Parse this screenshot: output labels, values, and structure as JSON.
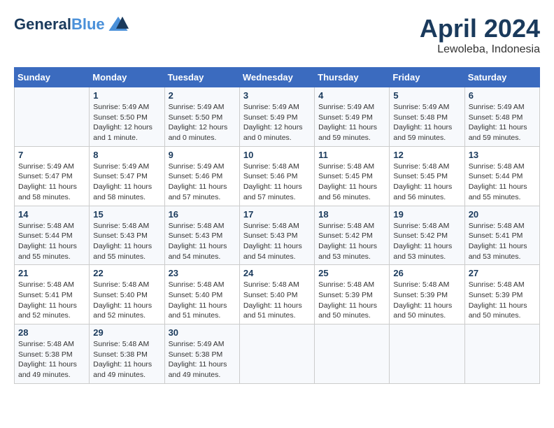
{
  "header": {
    "logo_line1": "General",
    "logo_line2": "Blue",
    "month": "April 2024",
    "location": "Lewoleba, Indonesia"
  },
  "days_of_week": [
    "Sunday",
    "Monday",
    "Tuesday",
    "Wednesday",
    "Thursday",
    "Friday",
    "Saturday"
  ],
  "weeks": [
    [
      {
        "day": "",
        "info": ""
      },
      {
        "day": "1",
        "info": "Sunrise: 5:49 AM\nSunset: 5:50 PM\nDaylight: 12 hours\nand 1 minute."
      },
      {
        "day": "2",
        "info": "Sunrise: 5:49 AM\nSunset: 5:50 PM\nDaylight: 12 hours\nand 0 minutes."
      },
      {
        "day": "3",
        "info": "Sunrise: 5:49 AM\nSunset: 5:49 PM\nDaylight: 12 hours\nand 0 minutes."
      },
      {
        "day": "4",
        "info": "Sunrise: 5:49 AM\nSunset: 5:49 PM\nDaylight: 11 hours\nand 59 minutes."
      },
      {
        "day": "5",
        "info": "Sunrise: 5:49 AM\nSunset: 5:48 PM\nDaylight: 11 hours\nand 59 minutes."
      },
      {
        "day": "6",
        "info": "Sunrise: 5:49 AM\nSunset: 5:48 PM\nDaylight: 11 hours\nand 59 minutes."
      }
    ],
    [
      {
        "day": "7",
        "info": "Sunrise: 5:49 AM\nSunset: 5:47 PM\nDaylight: 11 hours\nand 58 minutes."
      },
      {
        "day": "8",
        "info": "Sunrise: 5:49 AM\nSunset: 5:47 PM\nDaylight: 11 hours\nand 58 minutes."
      },
      {
        "day": "9",
        "info": "Sunrise: 5:49 AM\nSunset: 5:46 PM\nDaylight: 11 hours\nand 57 minutes."
      },
      {
        "day": "10",
        "info": "Sunrise: 5:48 AM\nSunset: 5:46 PM\nDaylight: 11 hours\nand 57 minutes."
      },
      {
        "day": "11",
        "info": "Sunrise: 5:48 AM\nSunset: 5:45 PM\nDaylight: 11 hours\nand 56 minutes."
      },
      {
        "day": "12",
        "info": "Sunrise: 5:48 AM\nSunset: 5:45 PM\nDaylight: 11 hours\nand 56 minutes."
      },
      {
        "day": "13",
        "info": "Sunrise: 5:48 AM\nSunset: 5:44 PM\nDaylight: 11 hours\nand 55 minutes."
      }
    ],
    [
      {
        "day": "14",
        "info": "Sunrise: 5:48 AM\nSunset: 5:44 PM\nDaylight: 11 hours\nand 55 minutes."
      },
      {
        "day": "15",
        "info": "Sunrise: 5:48 AM\nSunset: 5:43 PM\nDaylight: 11 hours\nand 55 minutes."
      },
      {
        "day": "16",
        "info": "Sunrise: 5:48 AM\nSunset: 5:43 PM\nDaylight: 11 hours\nand 54 minutes."
      },
      {
        "day": "17",
        "info": "Sunrise: 5:48 AM\nSunset: 5:43 PM\nDaylight: 11 hours\nand 54 minutes."
      },
      {
        "day": "18",
        "info": "Sunrise: 5:48 AM\nSunset: 5:42 PM\nDaylight: 11 hours\nand 53 minutes."
      },
      {
        "day": "19",
        "info": "Sunrise: 5:48 AM\nSunset: 5:42 PM\nDaylight: 11 hours\nand 53 minutes."
      },
      {
        "day": "20",
        "info": "Sunrise: 5:48 AM\nSunset: 5:41 PM\nDaylight: 11 hours\nand 53 minutes."
      }
    ],
    [
      {
        "day": "21",
        "info": "Sunrise: 5:48 AM\nSunset: 5:41 PM\nDaylight: 11 hours\nand 52 minutes."
      },
      {
        "day": "22",
        "info": "Sunrise: 5:48 AM\nSunset: 5:40 PM\nDaylight: 11 hours\nand 52 minutes."
      },
      {
        "day": "23",
        "info": "Sunrise: 5:48 AM\nSunset: 5:40 PM\nDaylight: 11 hours\nand 51 minutes."
      },
      {
        "day": "24",
        "info": "Sunrise: 5:48 AM\nSunset: 5:40 PM\nDaylight: 11 hours\nand 51 minutes."
      },
      {
        "day": "25",
        "info": "Sunrise: 5:48 AM\nSunset: 5:39 PM\nDaylight: 11 hours\nand 50 minutes."
      },
      {
        "day": "26",
        "info": "Sunrise: 5:48 AM\nSunset: 5:39 PM\nDaylight: 11 hours\nand 50 minutes."
      },
      {
        "day": "27",
        "info": "Sunrise: 5:48 AM\nSunset: 5:39 PM\nDaylight: 11 hours\nand 50 minutes."
      }
    ],
    [
      {
        "day": "28",
        "info": "Sunrise: 5:48 AM\nSunset: 5:38 PM\nDaylight: 11 hours\nand 49 minutes."
      },
      {
        "day": "29",
        "info": "Sunrise: 5:48 AM\nSunset: 5:38 PM\nDaylight: 11 hours\nand 49 minutes."
      },
      {
        "day": "30",
        "info": "Sunrise: 5:49 AM\nSunset: 5:38 PM\nDaylight: 11 hours\nand 49 minutes."
      },
      {
        "day": "",
        "info": ""
      },
      {
        "day": "",
        "info": ""
      },
      {
        "day": "",
        "info": ""
      },
      {
        "day": "",
        "info": ""
      }
    ]
  ]
}
